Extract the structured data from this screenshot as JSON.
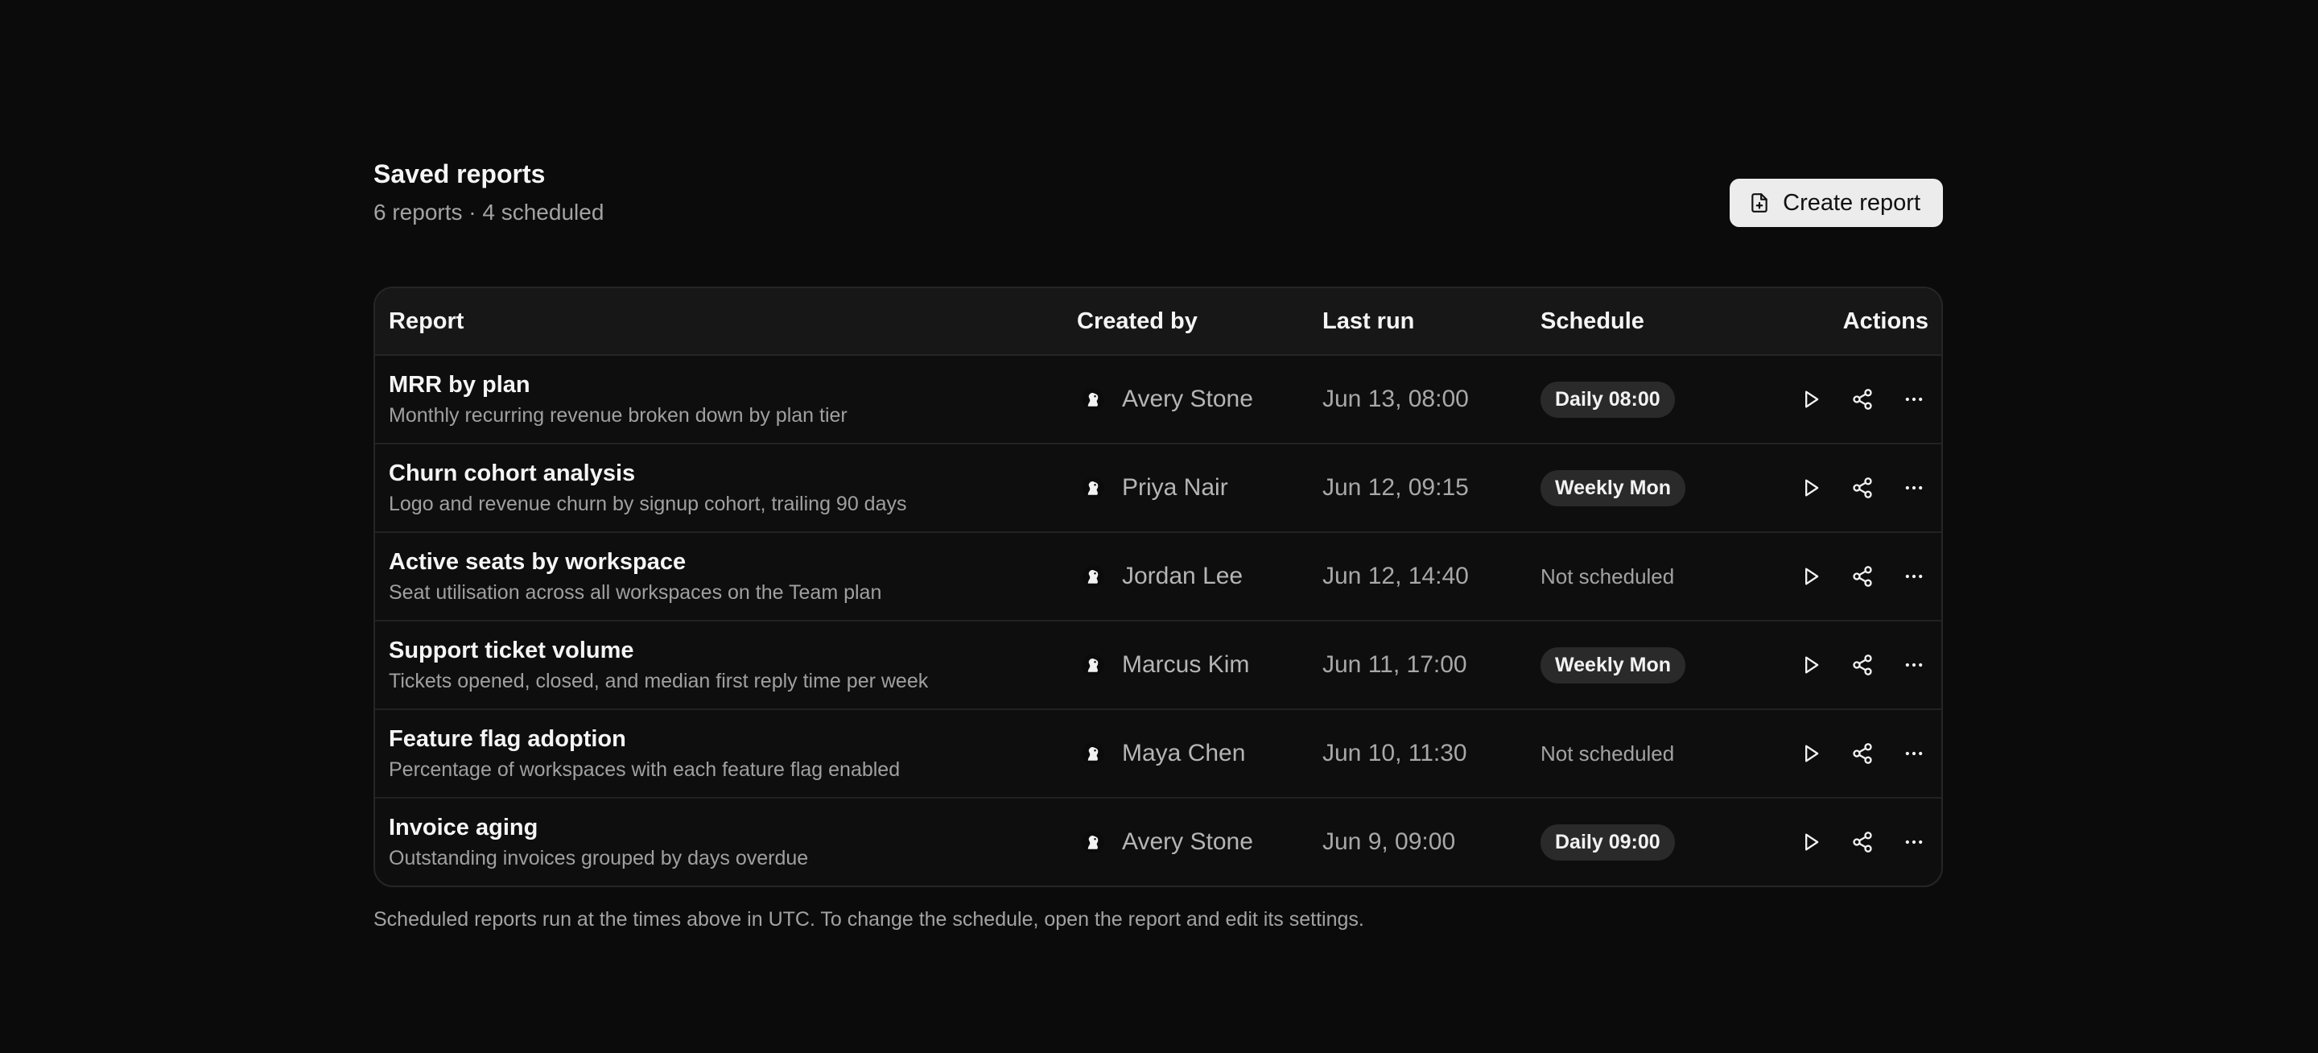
{
  "header": {
    "title": "Saved reports",
    "subtitle": "6 reports · 4 scheduled",
    "create_label": "Create report"
  },
  "table": {
    "columns": [
      "Report",
      "Created by",
      "Last run",
      "Schedule",
      "Actions"
    ],
    "rows": [
      {
        "name": "MRR by plan",
        "description": "Monthly recurring revenue broken down by plan tier",
        "created_by": "Avery Stone",
        "last_run": "Jun 13, 08:00",
        "schedule": "Daily 08:00",
        "scheduled": true
      },
      {
        "name": "Churn cohort analysis",
        "description": "Logo and revenue churn by signup cohort, trailing 90 days",
        "created_by": "Priya Nair",
        "last_run": "Jun 12, 09:15",
        "schedule": "Weekly Mon",
        "scheduled": true
      },
      {
        "name": "Active seats by workspace",
        "description": "Seat utilisation across all workspaces on the Team plan",
        "created_by": "Jordan Lee",
        "last_run": "Jun 12, 14:40",
        "schedule": "Not scheduled",
        "scheduled": false
      },
      {
        "name": "Support ticket volume",
        "description": "Tickets opened, closed, and median first reply time per week",
        "created_by": "Marcus Kim",
        "last_run": "Jun 11, 17:00",
        "schedule": "Weekly Mon",
        "scheduled": true
      },
      {
        "name": "Feature flag adoption",
        "description": "Percentage of workspaces with each feature flag enabled",
        "created_by": "Maya Chen",
        "last_run": "Jun 10, 11:30",
        "schedule": "Not scheduled",
        "scheduled": false
      },
      {
        "name": "Invoice aging",
        "description": "Outstanding invoices grouped by days overdue",
        "created_by": "Avery Stone",
        "last_run": "Jun 9, 09:00",
        "schedule": "Daily 09:00",
        "scheduled": true
      }
    ]
  },
  "footnote": "Scheduled reports run at the times above in UTC. To change the schedule, open the report and edit its settings.",
  "icons": {
    "create": "file-plus-icon",
    "avatar": "user-avatar-icon",
    "run": "play-icon",
    "share": "share-icon",
    "more": "more-horizontal-icon"
  },
  "colors": {
    "background": "#0b0b0b",
    "surface": "#171717",
    "badge": "#2a2a2a",
    "button": "#ececec"
  }
}
